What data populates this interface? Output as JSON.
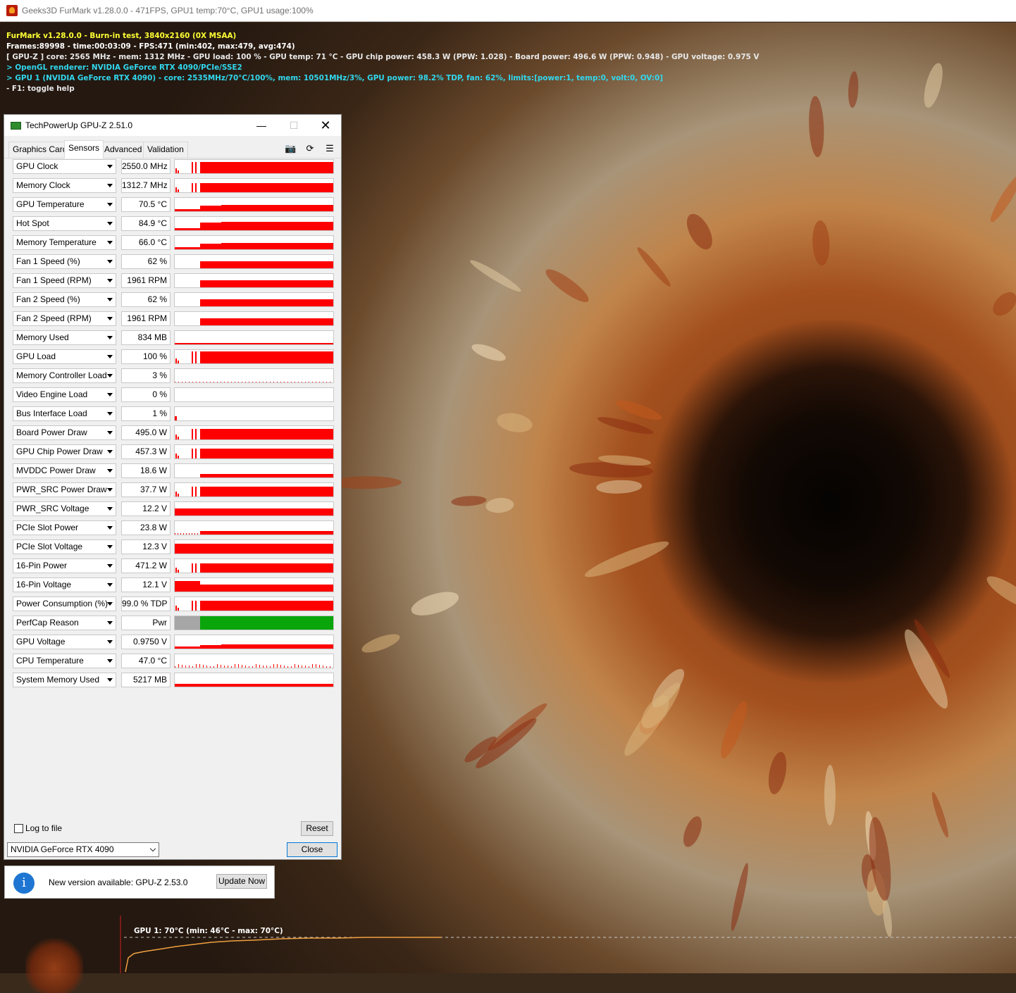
{
  "furmark": {
    "window_title": "Geeks3D FurMark v1.28.0.0 - 471FPS, GPU1 temp:70°C, GPU1 usage:100%",
    "overlay": [
      {
        "text": "FurMark v1.28.0.0 - Burn-in test, 3840x2160 (0X MSAA)",
        "color": "yellow"
      },
      {
        "text": "Frames:89998 - time:00:03:09 - FPS:471 (min:402, max:479, avg:474)",
        "color": "white"
      },
      {
        "text": "[ GPU-Z ] core: 2565 MHz - mem: 1312 MHz - GPU load: 100 % - GPU temp: 71 °C - GPU chip power: 458.3 W (PPW: 1.028) - Board power: 496.6 W (PPW: 0.948) - GPU voltage: 0.975 V",
        "color": "light"
      },
      {
        "text": "> OpenGL renderer: NVIDIA GeForce RTX 4090/PCIe/SSE2",
        "color": "cyan"
      },
      {
        "text": "> GPU 1 (NVIDIA GeForce RTX 4090) - core: 2535MHz/70°C/100%, mem: 10501MHz/3%, GPU power: 98.2% TDP, fan: 62%, limits:[power:1, temp:0, volt:0, OV:0]",
        "color": "cyan"
      },
      {
        "text": "- F1: toggle help",
        "color": "light"
      }
    ],
    "temp_graph_label": "GPU 1: 70°C (min: 46°C - max: 70°C)"
  },
  "gpuz": {
    "title": "TechPowerUp GPU-Z 2.51.0",
    "tabs": [
      "Graphics Card",
      "Sensors",
      "Advanced",
      "Validation"
    ],
    "active_tab": "Sensors",
    "toolbar_icons": [
      "camera-icon",
      "refresh-icon",
      "menu-icon"
    ],
    "sensors": [
      {
        "label": "GPU Clock",
        "value": "2550.0 MHz",
        "level": 0.85,
        "pattern": "spiky"
      },
      {
        "label": "Memory Clock",
        "value": "1312.7 MHz",
        "level": 0.7,
        "pattern": "spiky"
      },
      {
        "label": "GPU Temperature",
        "value": "70.5 °C",
        "level": 0.45,
        "pattern": "ramp"
      },
      {
        "label": "Hot Spot",
        "value": "84.9 °C",
        "level": 0.65,
        "pattern": "ramp"
      },
      {
        "label": "Memory Temperature",
        "value": "66.0 °C",
        "level": 0.45,
        "pattern": "ramp"
      },
      {
        "label": "Fan 1 Speed (%)",
        "value": "62 %",
        "level": 0.5,
        "pattern": "late"
      },
      {
        "label": "Fan 1 Speed (RPM)",
        "value": "1961 RPM",
        "level": 0.5,
        "pattern": "late"
      },
      {
        "label": "Fan 2 Speed (%)",
        "value": "62 %",
        "level": 0.5,
        "pattern": "late"
      },
      {
        "label": "Fan 2 Speed (RPM)",
        "value": "1961 RPM",
        "level": 0.5,
        "pattern": "late"
      },
      {
        "label": "Memory Used",
        "value": "834 MB",
        "level": 0.08,
        "pattern": "flat"
      },
      {
        "label": "GPU Load",
        "value": "100 %",
        "level": 0.9,
        "pattern": "spiky"
      },
      {
        "label": "Memory Controller Load",
        "value": "3 %",
        "level": 0.05,
        "pattern": "noise"
      },
      {
        "label": "Video Engine Load",
        "value": "0 %",
        "level": 0.0,
        "pattern": "none"
      },
      {
        "label": "Bus Interface Load",
        "value": "1 %",
        "level": 0.02,
        "pattern": "start"
      },
      {
        "label": "Board Power Draw",
        "value": "495.0 W",
        "level": 0.8,
        "pattern": "spiky"
      },
      {
        "label": "GPU Chip Power Draw",
        "value": "457.3 W",
        "level": 0.75,
        "pattern": "spiky"
      },
      {
        "label": "MVDDC Power Draw",
        "value": "18.6 W",
        "level": 0.25,
        "pattern": "late"
      },
      {
        "label": "PWR_SRC Power Draw",
        "value": "37.7 W",
        "level": 0.75,
        "pattern": "spiky"
      },
      {
        "label": "PWR_SRC Voltage",
        "value": "12.2 V",
        "level": 0.5,
        "pattern": "full"
      },
      {
        "label": "PCIe Slot Power",
        "value": "23.8 W",
        "level": 0.25,
        "pattern": "noise-late"
      },
      {
        "label": "PCIe Slot Voltage",
        "value": "12.3 V",
        "level": 0.75,
        "pattern": "full"
      },
      {
        "label": "16-Pin Power",
        "value": "471.2 W",
        "level": 0.7,
        "pattern": "spiky"
      },
      {
        "label": "16-Pin Voltage",
        "value": "12.1 V",
        "level": 0.5,
        "pattern": "drop"
      },
      {
        "label": "Power Consumption (%)",
        "value": "99.0 % TDP",
        "level": 0.75,
        "pattern": "spiky"
      },
      {
        "label": "PerfCap Reason",
        "value": "Pwr",
        "level": 1.0,
        "pattern": "perfcap"
      },
      {
        "label": "GPU Voltage",
        "value": "0.9750 V",
        "level": 0.3,
        "pattern": "ramp"
      },
      {
        "label": "CPU Temperature",
        "value": "47.0 °C",
        "level": 0.2,
        "pattern": "noise"
      },
      {
        "label": "System Memory Used",
        "value": "5217 MB",
        "level": 0.2,
        "pattern": "flat"
      }
    ],
    "log_to_file_label": "Log to file",
    "log_to_file_checked": false,
    "reset_label": "Reset",
    "device": "NVIDIA GeForce RTX 4090",
    "close_label": "Close"
  },
  "update_notice": {
    "message": "New version available: GPU-Z 2.53.0",
    "button": "Update Now"
  },
  "colors": {
    "graph_red": "#ff0000",
    "perfcap_gray": "#a6a6a6",
    "perfcap_green": "#0aa50a",
    "temp_line": "#f0a040"
  }
}
